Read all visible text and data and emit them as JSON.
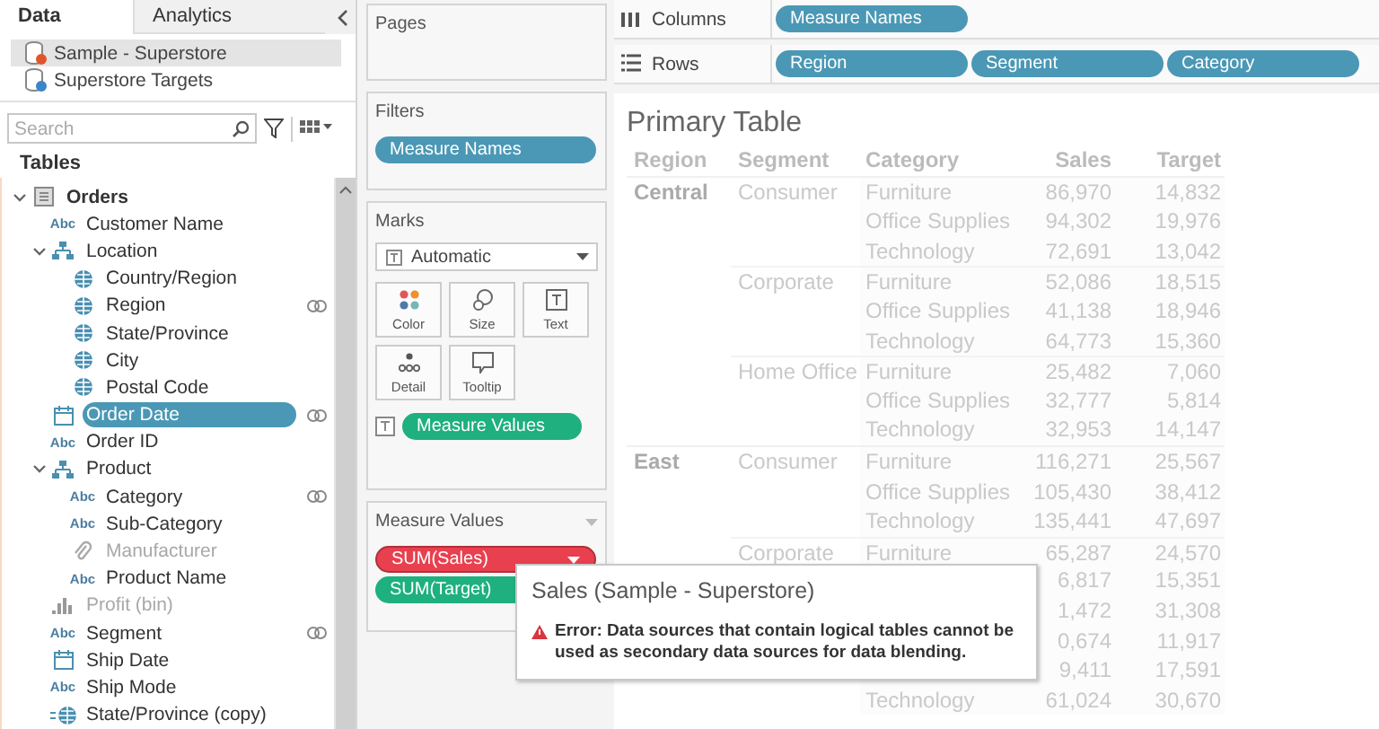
{
  "data_pane": {
    "tabs": [
      {
        "label": "Data",
        "selected": true
      },
      {
        "label": "Analytics",
        "selected": false
      }
    ],
    "sources": [
      {
        "name": "Sample - Superstore",
        "kind": "primary",
        "selected": true
      },
      {
        "name": "Superstore Targets",
        "kind": "secondary",
        "selected": false
      }
    ],
    "search": {
      "placeholder": "Search"
    },
    "section_title": "Tables",
    "fields": [
      {
        "name": "Orders",
        "kind": "table",
        "expanded": true,
        "selected": false,
        "disabled": false,
        "linked": false,
        "children": [
          {
            "name": "Customer Name",
            "kind": "string",
            "badge": "Abc",
            "selected": false,
            "disabled": false,
            "linked": false
          },
          {
            "name": "Location",
            "kind": "hierarchy",
            "expanded": true,
            "selected": false,
            "disabled": false,
            "linked": false,
            "children": [
              {
                "name": "Country/Region",
                "kind": "geo",
                "selected": false,
                "disabled": false,
                "linked": false
              },
              {
                "name": "Region",
                "kind": "geo",
                "selected": false,
                "disabled": false,
                "linked": true
              },
              {
                "name": "State/Province",
                "kind": "geo",
                "selected": false,
                "disabled": false,
                "linked": false
              },
              {
                "name": "City",
                "kind": "geo",
                "selected": false,
                "disabled": false,
                "linked": false
              },
              {
                "name": "Postal Code",
                "kind": "geo",
                "selected": false,
                "disabled": false,
                "linked": false
              }
            ]
          },
          {
            "name": "Order Date",
            "kind": "date",
            "selected": true,
            "disabled": false,
            "linked": true
          },
          {
            "name": "Order ID",
            "kind": "string",
            "badge": "Abc",
            "selected": false,
            "disabled": false,
            "linked": false
          },
          {
            "name": "Product",
            "kind": "hierarchy",
            "expanded": true,
            "selected": false,
            "disabled": false,
            "linked": false,
            "children": [
              {
                "name": "Category",
                "kind": "string",
                "badge": "Abc",
                "selected": false,
                "disabled": false,
                "linked": true
              },
              {
                "name": "Sub-Category",
                "kind": "string",
                "badge": "Abc",
                "selected": false,
                "disabled": false,
                "linked": false
              },
              {
                "name": "Manufacturer",
                "kind": "group",
                "selected": false,
                "disabled": true,
                "linked": false
              },
              {
                "name": "Product Name",
                "kind": "string",
                "badge": "Abc",
                "selected": false,
                "disabled": false,
                "linked": false
              }
            ]
          },
          {
            "name": "Profit (bin)",
            "kind": "bin",
            "selected": false,
            "disabled": true,
            "linked": false
          },
          {
            "name": "Segment",
            "kind": "string",
            "badge": "Abc",
            "selected": false,
            "disabled": false,
            "linked": true
          },
          {
            "name": "Ship Date",
            "kind": "date",
            "selected": false,
            "disabled": false,
            "linked": false
          },
          {
            "name": "Ship Mode",
            "kind": "string",
            "badge": "Abc",
            "selected": false,
            "disabled": false,
            "linked": false
          },
          {
            "name": "State/Province (copy)",
            "kind": "calc_geo",
            "selected": false,
            "disabled": false,
            "linked": false
          }
        ]
      }
    ]
  },
  "cards": {
    "pages": {
      "title": "Pages"
    },
    "filters": {
      "title": "Filters",
      "pills": [
        {
          "label": "Measure Names",
          "kind": "dimension"
        }
      ]
    },
    "marks": {
      "title": "Marks",
      "mark_type": "Automatic",
      "buttons": [
        {
          "label": "Color",
          "kind": "color"
        },
        {
          "label": "Size",
          "kind": "size"
        },
        {
          "label": "Text",
          "kind": "text"
        },
        {
          "label": "Detail",
          "kind": "detail"
        },
        {
          "label": "Tooltip",
          "kind": "tooltip"
        }
      ],
      "pills": [
        {
          "label": "Measure Values",
          "kind": "measure"
        }
      ]
    },
    "measure_values": {
      "title": "Measure Values",
      "pills": [
        {
          "label": "SUM(Sales)",
          "kind": "error"
        },
        {
          "label": "SUM(Target)",
          "kind": "measure"
        }
      ]
    }
  },
  "shelves": [
    {
      "label": "Columns",
      "kind": "columns",
      "pills": [
        {
          "label": "Measure Names",
          "kind": "dimension"
        }
      ]
    },
    {
      "label": "Rows",
      "kind": "rows",
      "pills": [
        {
          "label": "Region",
          "kind": "dimension"
        },
        {
          "label": "Segment",
          "kind": "dimension"
        },
        {
          "label": "Category",
          "kind": "dimension"
        }
      ]
    }
  ],
  "view": {
    "title": "Primary Table",
    "table": {
      "columns": [
        "Region",
        "Segment",
        "Category",
        "Sales",
        "Target"
      ],
      "rows": [
        {
          "region": "Central",
          "segment": "Consumer",
          "category": "Furniture",
          "sales": "86,970",
          "target": "14,832"
        },
        {
          "category": "Office Supplies",
          "sales": "94,302",
          "target": "19,976"
        },
        {
          "category": "Technology",
          "sales": "72,691",
          "target": "13,042"
        },
        {
          "segment": "Corporate",
          "category": "Furniture",
          "sales": "52,086",
          "target": "18,515"
        },
        {
          "category": "Office Supplies",
          "sales": "41,138",
          "target": "18,946"
        },
        {
          "category": "Technology",
          "sales": "64,773",
          "target": "15,360"
        },
        {
          "segment": "Home Office",
          "category": "Furniture",
          "sales": "25,482",
          "target": "7,060"
        },
        {
          "category": "Office Supplies",
          "sales": "32,777",
          "target": "5,814"
        },
        {
          "category": "Technology",
          "sales": "32,953",
          "target": "14,147"
        },
        {
          "region": "East",
          "segment": "Consumer",
          "category": "Furniture",
          "sales": "116,271",
          "target": "25,567"
        },
        {
          "category": "Office Supplies",
          "sales": "105,430",
          "target": "38,412"
        },
        {
          "category": "Technology",
          "sales": "135,441",
          "target": "47,697"
        },
        {
          "segment": "Corporate",
          "category": "Furniture",
          "sales": "65,287",
          "target": "24,570"
        },
        {
          "sales": "6,817",
          "target": "15,351"
        },
        {
          "sales": "1,472",
          "target": "31,308"
        },
        {
          "sales": "0,674",
          "target": "11,917"
        },
        {
          "sales": "9,411",
          "target": "17,591"
        },
        {
          "category": "Technology",
          "sales": "61,024",
          "target": "30,670"
        }
      ]
    }
  },
  "tooltip": {
    "title": "Sales (Sample - Superstore)",
    "message": "Error: Data sources that contain logical tables cannot be used as secondary data sources for data blending."
  }
}
